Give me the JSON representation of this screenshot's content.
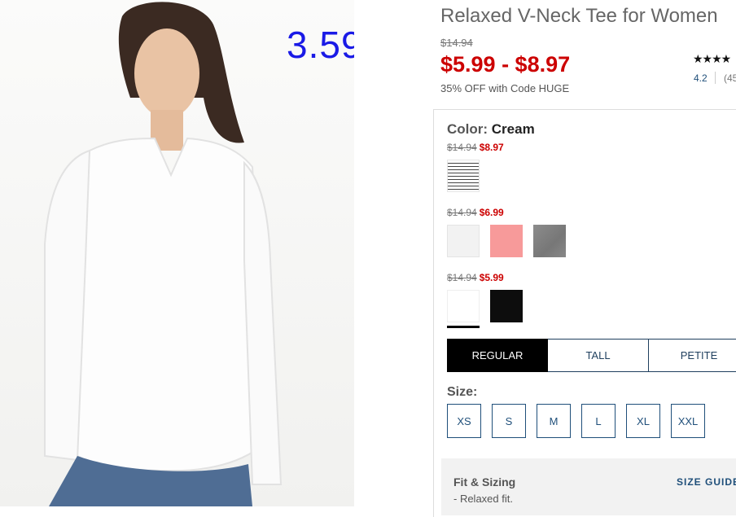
{
  "overlay": {
    "price": "3.59$"
  },
  "product": {
    "title": "Relaxed V-Neck Tee for Women",
    "original_price": "$14.94",
    "price_range": "$5.99 - $8.97",
    "promo": "35% OFF with Code HUGE",
    "stars": "★★★★",
    "rating": "4.2",
    "reviews": "(45"
  },
  "color": {
    "label": "Color:",
    "value": "Cream"
  },
  "price_groups": [
    {
      "was": "$14.94",
      "now": "$8.97"
    },
    {
      "was": "$14.94",
      "now": "$6.99"
    },
    {
      "was": "$14.94",
      "now": "$5.99"
    }
  ],
  "fit_tabs": [
    {
      "label": "REGULAR",
      "active": true
    },
    {
      "label": "TALL",
      "active": false
    },
    {
      "label": "PETITE",
      "active": false
    }
  ],
  "size": {
    "label": "Size:",
    "options": [
      "XS",
      "S",
      "M",
      "L",
      "XL",
      "XXL"
    ]
  },
  "fit_sizing": {
    "title": "Fit & Sizing",
    "bullet": "- Relaxed fit.",
    "guide_link": "SIZE GUIDE"
  },
  "colors": {
    "sale_red": "#cc0000",
    "link_blue": "#1f4f7a",
    "overlay_blue": "#1a1ae6"
  }
}
